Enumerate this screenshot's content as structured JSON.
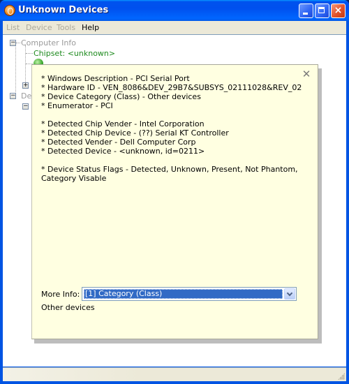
{
  "window": {
    "title": "Unknown Devices",
    "controls": {
      "minimize": "minimize",
      "maximize": "maximize",
      "close": "×"
    }
  },
  "menu": {
    "items": [
      {
        "label": "List",
        "enabled": false
      },
      {
        "label": "Device",
        "enabled": false
      },
      {
        "label": "Tools",
        "enabled": false
      },
      {
        "label": "Help",
        "enabled": true
      }
    ]
  },
  "tree": {
    "root1": {
      "label": "Computer Info",
      "expanded": true
    },
    "chipset": {
      "label": "Chipset: <unknown>"
    },
    "partially_hidden_item": {
      "label": ""
    },
    "root2": {
      "label": "De",
      "expanded": true
    }
  },
  "popup": {
    "close_glyph": "✕",
    "lines": [
      "* Windows Description - PCI Serial Port",
      "* Hardware ID - VEN_8086&DEV_29B7&SUBSYS_02111028&REV_02",
      "* Device Category (Class) - Other devices",
      "* Enumerator - PCI",
      "* Detected Chip Vender - Intel Corporation",
      "* Detected Chip Device - (??) Serial KT Controller",
      "* Detected Vender - Dell Computer Corp",
      "* Detected Device - <unknown, id=0211>",
      "* Device Status Flags - Detected, Unknown, Present, Not Phantom,",
      "Category Visable"
    ],
    "more_info_label": "More Info:",
    "more_info_selected": "[1] Category (Class)",
    "more_info_value": "Other devices"
  },
  "colors": {
    "titlebar": "#0054e3",
    "popup_bg": "#ffffe1",
    "selection": "#316ac5",
    "tree_green": "#1e8a1e"
  }
}
